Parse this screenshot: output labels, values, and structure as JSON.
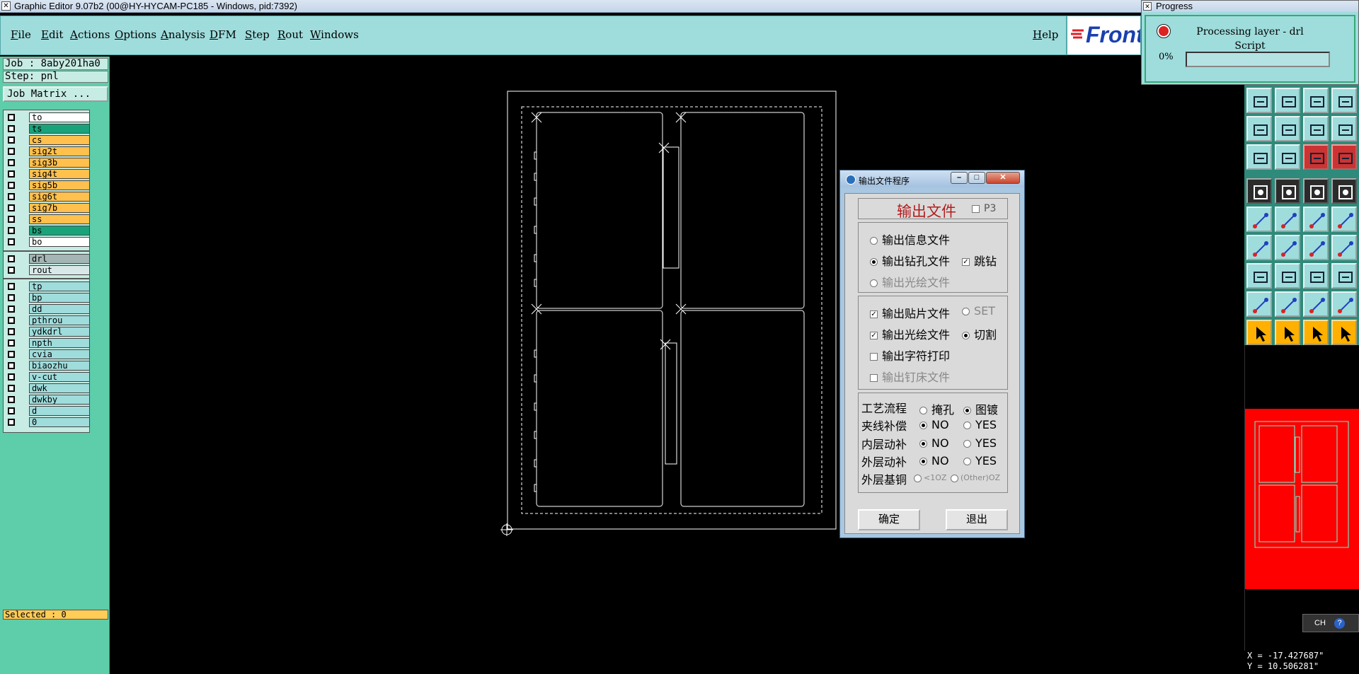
{
  "window": {
    "title": "Graphic Editor 9.07b2 (00@HY-HYCAM-PC185 - Windows, pid:7392)"
  },
  "menu": {
    "items": [
      "File",
      "Edit",
      "Actions",
      "Options",
      "Analysis",
      "DFM",
      "Step",
      "Rout",
      "Windows"
    ],
    "help": "Help"
  },
  "logo": {
    "text": "Front"
  },
  "job": {
    "job_line": "Job : 8aby201ha0",
    "step_line": "Step: pnl",
    "matrix_button": "Job Matrix ..."
  },
  "layers": {
    "board": [
      {
        "name": "to",
        "color": "#ffffff"
      },
      {
        "name": "ts",
        "color": "#1aa37a"
      },
      {
        "name": "cs",
        "color": "#ffc04d"
      },
      {
        "name": "sig2t",
        "color": "#ffc04d"
      },
      {
        "name": "sig3b",
        "color": "#ffc04d"
      },
      {
        "name": "sig4t",
        "color": "#ffc04d"
      },
      {
        "name": "sig5b",
        "color": "#ffc04d"
      },
      {
        "name": "sig6t",
        "color": "#ffc04d"
      },
      {
        "name": "sig7b",
        "color": "#ffc04d"
      },
      {
        "name": "ss",
        "color": "#ffc04d"
      },
      {
        "name": "bs",
        "color": "#1aa37a"
      },
      {
        "name": "bo",
        "color": "#ffffff"
      }
    ],
    "drill": [
      {
        "name": "drl",
        "color": "#a3b5b5"
      },
      {
        "name": "rout",
        "color": "#d8e8e8"
      }
    ],
    "misc": [
      {
        "name": "tp",
        "color": "#9fdcdc"
      },
      {
        "name": "bp",
        "color": "#9fdcdc"
      },
      {
        "name": "dd",
        "color": "#9fdcdc"
      },
      {
        "name": "pthrou",
        "color": "#9fdcdc"
      },
      {
        "name": "ydkdrl",
        "color": "#9fdcdc"
      },
      {
        "name": "npth",
        "color": "#9fdcdc"
      },
      {
        "name": "cvia",
        "color": "#9fdcdc"
      },
      {
        "name": "biaozhu",
        "color": "#9fdcdc"
      },
      {
        "name": "v-cut",
        "color": "#9fdcdc"
      },
      {
        "name": "dwk",
        "color": "#9fdcdc"
      },
      {
        "name": "dwkby",
        "color": "#9fdcdc"
      },
      {
        "name": "d",
        "color": "#9fdcdc"
      },
      {
        "name": "0",
        "color": "#9fdcdc"
      }
    ]
  },
  "status": {
    "selected": "Selected : 0"
  },
  "progress": {
    "title": "Progress",
    "message": "Processing layer - drl",
    "sub": "Script",
    "percent_label": "0%",
    "fraction": 0.0
  },
  "toolbar": {
    "buttons": [
      [
        "zoom-home-icon",
        "zoom-out-icon",
        "zoom-back-icon",
        "snap-icon"
      ],
      [
        "fit-all-icon",
        "pan-icon",
        "scale-1-2-icon",
        "help-query-icon"
      ],
      [
        "measure-icon",
        "grid-icon",
        "layer-color-icon",
        "layer-swap-icon"
      ],
      [
        "camera-icon",
        "edit-shape-icon",
        "ruler-icon",
        "dot-icon"
      ],
      [
        "connect-icon",
        "delete-node-icon",
        "node-add-icon",
        "node-move-icon"
      ],
      [
        "line-icon",
        "slash-icon",
        "arc-icon",
        "mirror-icon"
      ],
      [
        "select-box-icon",
        "line-minus-icon",
        "dimension-icon",
        "cluster-icon"
      ],
      [
        "triangle-icon",
        "angle-icon",
        "arch-icon",
        "shape-edit-icon"
      ],
      [
        "pointer-icon",
        "pointer-select-icon",
        "pointer-zoom-icon",
        "route-icon"
      ]
    ]
  },
  "ch_widget": {
    "label": "CH",
    "help": "?"
  },
  "coords": {
    "x": "X = -17.427687\"",
    "y": "Y = 10.506281\""
  },
  "dialog": {
    "title": "输出文件程序",
    "header": "输出文件",
    "p3_label": "P3",
    "group1": [
      {
        "label": "输出信息文件",
        "type": "radio",
        "on": false,
        "disabled": false
      },
      {
        "label": "输出钻孔文件",
        "type": "radio",
        "on": true,
        "disabled": false
      },
      {
        "label": "输出光绘文件",
        "type": "radio",
        "on": false,
        "disabled": true
      }
    ],
    "tiaozuan_label": "跳钻",
    "group2": [
      {
        "label": "输出贴片文件",
        "checked": true,
        "disabled": false
      },
      {
        "label": "输出光绘文件",
        "checked": true,
        "disabled": false
      },
      {
        "label": "输出字符打印",
        "checked": false,
        "disabled": false
      },
      {
        "label": "输出钉床文件",
        "checked": false,
        "disabled": true
      }
    ],
    "set_label": "SET",
    "qiege_label": "切割",
    "group3": {
      "process_label": "工艺流程",
      "process_opt1": "掩孔",
      "process_opt2": "图镀",
      "jiaxian_label": "夹线补偿",
      "neiceng_label": "内层动补",
      "waiceng_label": "外层动补",
      "no_label": "NO",
      "yes_label": "YES",
      "copper_label": "外层基铜",
      "copper_opt1": "<1OZ",
      "copper_opt2": "(Other)OZ"
    },
    "ok_button": "确定",
    "exit_button": "退出"
  }
}
